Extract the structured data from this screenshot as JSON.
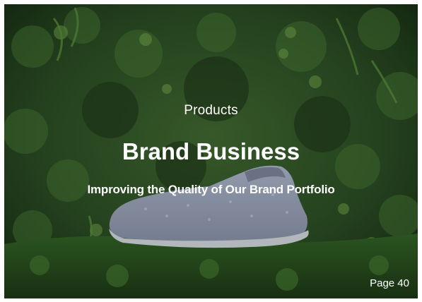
{
  "slide": {
    "eyebrow": "Products",
    "title": "Brand Business",
    "subtitle": "Improving the Quality of Our Brand Portfolio",
    "page_number": "Page 40"
  },
  "colors": {
    "text": "#ffffff",
    "foliage_dark": "#1f3a1a",
    "foliage_mid": "#2f5a26",
    "foliage_light": "#5c8a3c",
    "shoe_body": "#8a94a8",
    "shoe_sole": "#b9bec4"
  },
  "icons": {
    "background": "moss-foliage-photo",
    "product": "wool-sneaker-photo"
  }
}
